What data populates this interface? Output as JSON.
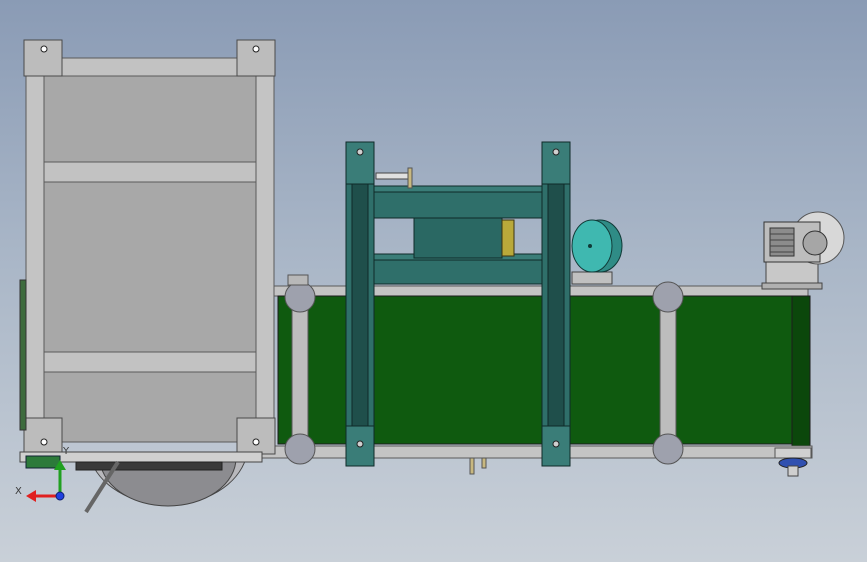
{
  "view": {
    "background_top": "#8a9bb5",
    "background_bottom": "#c9d0d8"
  },
  "colors": {
    "frame": "#c0c0c0",
    "frame_dark": "#6e6e6e",
    "panel": "#a8a8a8",
    "conveyor_belt": "#0f5a0f",
    "gantry": "#2f6f6a",
    "motor": "#3fb8b0",
    "accent_yellow": "#b9a93a",
    "axis_x": "#e02020",
    "axis_y": "#20a020",
    "axis_z": "#2040e0"
  },
  "triad": {
    "x_label": "X",
    "y_label": "Y"
  },
  "icons": [
    "coordinate-triad-icon"
  ]
}
